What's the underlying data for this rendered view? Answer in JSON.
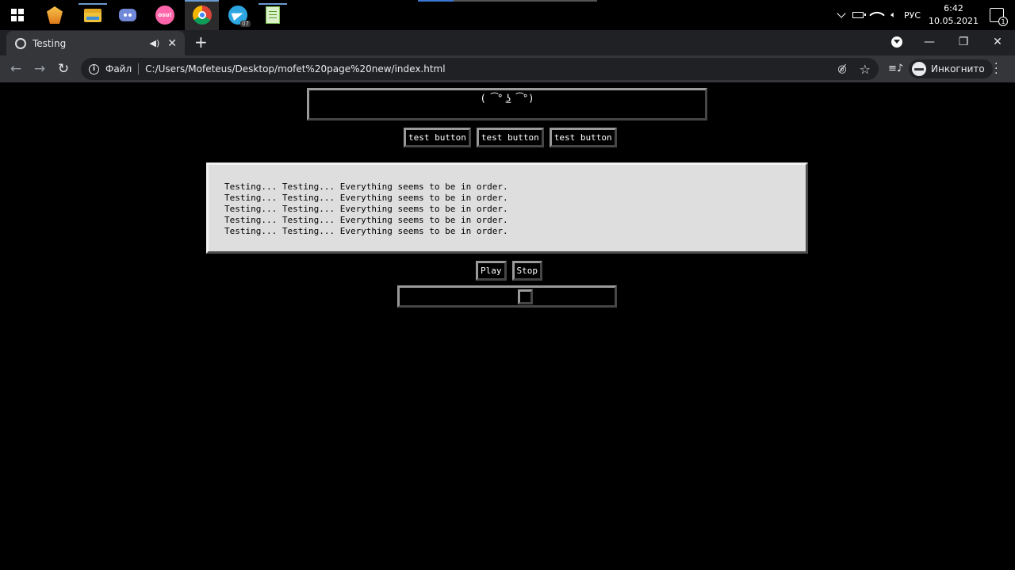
{
  "taskbar": {
    "apps": [
      {
        "name": "fl-studio",
        "active": false
      },
      {
        "name": "file-explorer",
        "active": true
      },
      {
        "name": "discord",
        "active": false
      },
      {
        "name": "osu",
        "label": "osu!",
        "active": false
      },
      {
        "name": "chrome",
        "active": true
      },
      {
        "name": "telegram",
        "badge": "07",
        "active": false
      },
      {
        "name": "notepad",
        "active": true
      }
    ],
    "language": "РУС",
    "time": "6:42",
    "date": "10.05.2021",
    "notifications": "1"
  },
  "browser": {
    "tab": {
      "title": "Testing"
    },
    "toolbar": {
      "scheme": "Файл",
      "url": "C:/Users/Mofeteus/Desktop/mofet%20page%20new/index.html",
      "profile_label": "Инкогнито"
    }
  },
  "page": {
    "face": "( ͡° ͜ʖ ͡°)",
    "test_buttons": [
      "test button",
      "test button",
      "test button"
    ],
    "log_lines": [
      "Testing... Testing... Everything seems to be in order.",
      "Testing... Testing... Everything seems to be in order.",
      "Testing... Testing... Everything seems to be in order.",
      "Testing... Testing... Everything seems to be in order.",
      "Testing... Testing... Everything seems to be in order."
    ],
    "play_label": "Play",
    "stop_label": "Stop",
    "slider_value": 0.59
  }
}
